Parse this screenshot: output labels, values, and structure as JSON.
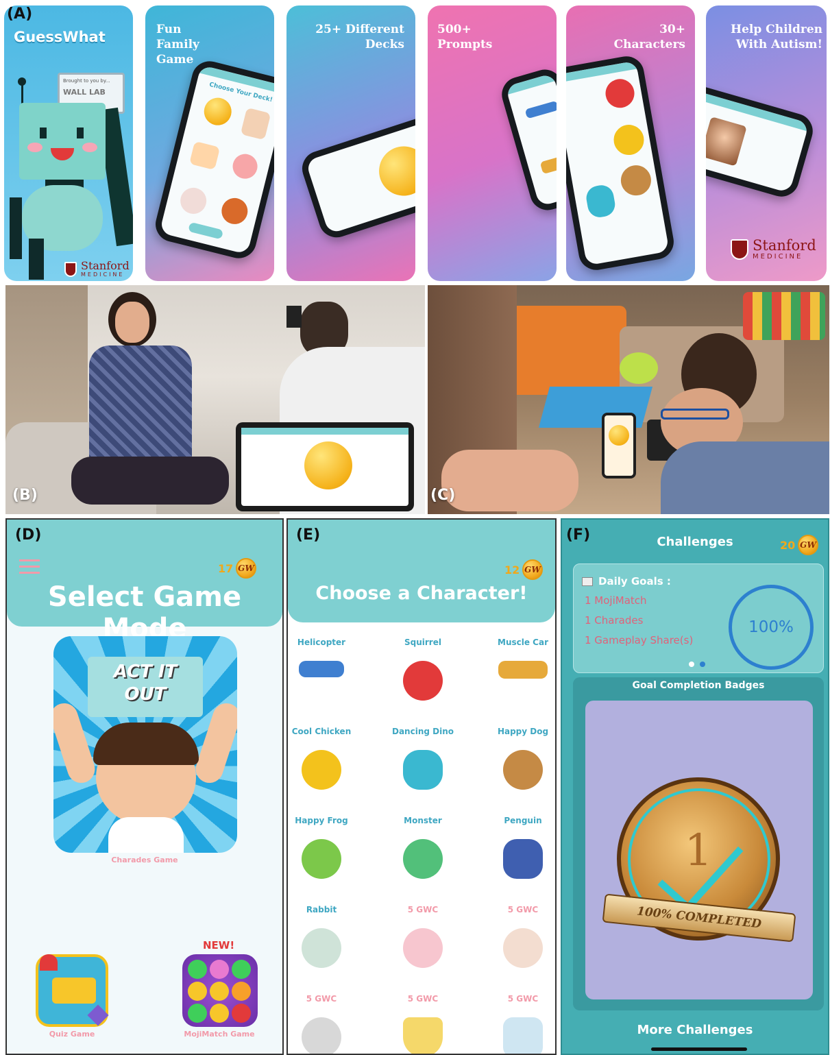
{
  "panel_a": {
    "label": "(A)",
    "logo": "GuessWhat",
    "brought_to_you": "Brought to you by...",
    "wall_lab": "WALL LAB",
    "cards": [
      {
        "title": "Fun\nFamily\nGame"
      },
      {
        "title": "25+ Different\nDecks"
      },
      {
        "title": "500+\nPrompts"
      },
      {
        "title": "30+\nCharacters"
      },
      {
        "title": "Help Children\nWith Autism!"
      }
    ],
    "deck_screen_title": "Choose Your Deck!",
    "stanford": {
      "word": "Stanford",
      "sub": "MEDICINE"
    }
  },
  "panel_b": {
    "label": "(B)"
  },
  "panel_c": {
    "label": "(C)"
  },
  "panel_d": {
    "label": "(D)",
    "coins": "17",
    "coin_icon": "GW",
    "title": "Select Game Mode",
    "act_it_out": "ACT IT\nOUT",
    "charades_label": "Charades Game",
    "new_badge": "NEW!",
    "quiz_label": "Quiz Game",
    "mojimatch_label": "MojiMatch Game"
  },
  "panel_e": {
    "label": "(E)",
    "coins": "12",
    "coin_icon": "GW",
    "title": "Choose a Character!",
    "characters": [
      {
        "name": "Helicopter",
        "locked": false,
        "color": "#3f7fd0"
      },
      {
        "name": "Squirrel",
        "locked": false,
        "color": "#e23a3a"
      },
      {
        "name": "Muscle Car",
        "locked": false,
        "color": "#e6a93a"
      },
      {
        "name": "Cool Chicken",
        "locked": false,
        "color": "#f3c21c"
      },
      {
        "name": "Dancing Dino",
        "locked": false,
        "color": "#3ab8d0"
      },
      {
        "name": "Happy Dog",
        "locked": false,
        "color": "#c58a45"
      },
      {
        "name": "Happy Frog",
        "locked": false,
        "color": "#7cc84a"
      },
      {
        "name": "Monster",
        "locked": false,
        "color": "#52c07a"
      },
      {
        "name": "Penguin",
        "locked": false,
        "color": "#3f5fb0"
      },
      {
        "name": "Rabbit",
        "locked": false,
        "color": "#cfe3d8"
      },
      {
        "name": "5 GWC",
        "locked": true,
        "color": "#f7c6cf"
      },
      {
        "name": "5 GWC",
        "locked": true,
        "color": "#f3ddd0"
      },
      {
        "name": "5 GWC",
        "locked": true,
        "color": "#d8d8d8"
      },
      {
        "name": "5 GWC",
        "locked": true,
        "color": "#f5d86a"
      },
      {
        "name": "5 GWC",
        "locked": true,
        "color": "#cfe6f2"
      }
    ]
  },
  "panel_f": {
    "label": "(F)",
    "title": "Challenges",
    "coins": "20",
    "coin_icon": "GW",
    "daily_goals_title": "Daily Goals :",
    "goals": [
      "1 MojiMatch",
      "1 Charades",
      "1 Gameplay Share(s)"
    ],
    "progress": "100%",
    "badges_title": "Goal Completion Badges",
    "badge_number": "1",
    "badge_ribbon": "100% COMPLETED",
    "more_challenges": "More Challenges"
  }
}
